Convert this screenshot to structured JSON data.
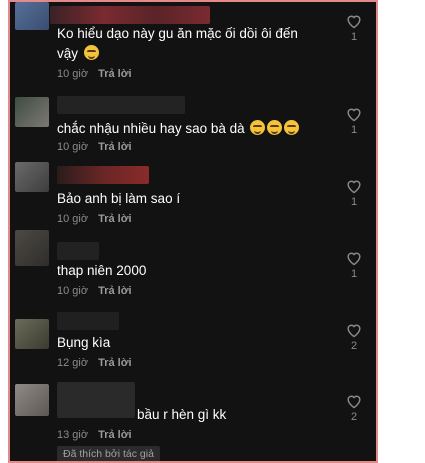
{
  "comments": [
    {
      "text": "Ko hiểu dạo này gu ăn mặc ối dồi ôi đến\nvậy",
      "emoji_count": 1,
      "time": "10 giờ",
      "reply": "Trả lời",
      "likes": "1"
    },
    {
      "text": "chắc nhậu nhiều hay sao bà dà",
      "emoji_count": 3,
      "time": "10 giờ",
      "reply": "Trả lời",
      "likes": "1"
    },
    {
      "text": "Bảo anh bị làm sao í",
      "emoji_count": 0,
      "time": "10 giờ",
      "reply": "Trả lời",
      "likes": "1"
    },
    {
      "text": "thap niên 2000",
      "emoji_count": 0,
      "time": "10 giờ",
      "reply": "Trả lời",
      "likes": "1"
    },
    {
      "text": "Bụng kìa",
      "emoji_count": 0,
      "time": "12 giờ",
      "reply": "Trả lời",
      "likes": "2"
    },
    {
      "text": "bầu r hèn gì kk",
      "emoji_count": 0,
      "time": "13 giờ",
      "reply": "Trả lời",
      "likes": "2"
    }
  ],
  "liked_by_author": "Đã thích bởi tác giả",
  "icons": {
    "like": "heart-outline-icon",
    "emoji": "grinning-face-icon"
  },
  "colors": {
    "background": "#121212",
    "border": "#e58a8a",
    "text": "#ffffff",
    "meta": "#8a8a8a"
  }
}
